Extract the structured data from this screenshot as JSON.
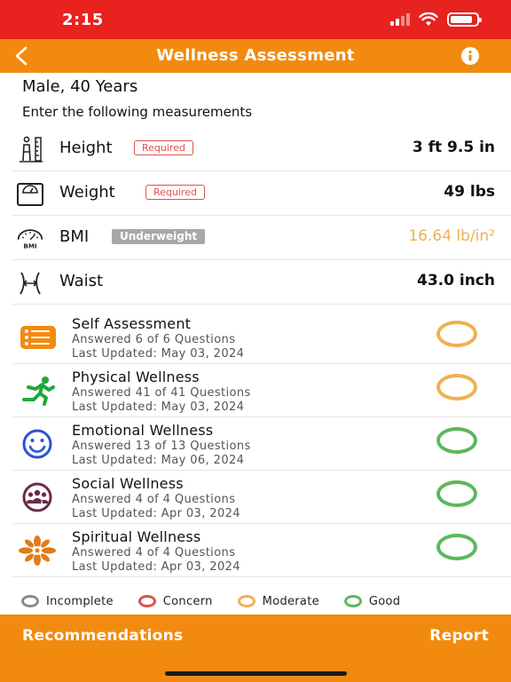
{
  "status_bar": {
    "time": "2:15",
    "battery_level": 0.85
  },
  "nav": {
    "title": "Wellness Assessment",
    "back_icon": "chevron-left-icon",
    "info_icon": "info-icon"
  },
  "profile": {
    "summary": "Male, 40 Years",
    "instruction": "Enter the following measurements"
  },
  "measurements": [
    {
      "label": "Height",
      "badge": "Required",
      "value": "3 ft 9.5 in",
      "icon": "height-icon"
    },
    {
      "label": "Weight",
      "badge": "Required",
      "value": "49 lbs",
      "icon": "scale-icon"
    },
    {
      "label": "BMI",
      "badge": "Underweight",
      "value": "16.64 lb/in²",
      "icon": "bmi-gauge-icon",
      "value_color": "#f0b052"
    },
    {
      "label": "Waist",
      "badge": "",
      "value": "43.0 inch",
      "icon": "waist-icon"
    }
  ],
  "sections": [
    {
      "title": "Self Assessment",
      "answered": "Answered 6 of 6 Questions",
      "updated": "Last Updated: May 03, 2024",
      "status": "Moderate",
      "icon": "checklist-icon"
    },
    {
      "title": "Physical Wellness",
      "answered": "Answered 41 of 41 Questions",
      "updated": "Last Updated: May 03, 2024",
      "status": "Moderate",
      "icon": "running-person-icon"
    },
    {
      "title": "Emotional Wellness",
      "answered": "Answered 13 of 13 Questions",
      "updated": "Last Updated: May 06, 2024",
      "status": "Good",
      "icon": "smiley-icon"
    },
    {
      "title": "Social Wellness",
      "answered": "Answered 4 of 4 Questions",
      "updated": "Last Updated: Apr 03, 2024",
      "status": "Good",
      "icon": "people-group-icon"
    },
    {
      "title": "Spiritual Wellness",
      "answered": "Answered 4 of 4 Questions",
      "updated": "Last Updated: Apr 03, 2024",
      "status": "Good",
      "icon": "lotus-icon"
    }
  ],
  "legend": [
    {
      "label": "Incomplete",
      "color": "#8a8a8a"
    },
    {
      "label": "Concern",
      "color": "#d9534f"
    },
    {
      "label": "Moderate",
      "color": "#f0b052"
    },
    {
      "label": "Good",
      "color": "#5cb85c"
    }
  ],
  "bottom": {
    "recommendations": "Recommendations",
    "report": "Report"
  },
  "colors": {
    "status_bar": "#e8221f",
    "accent": "#f28a10",
    "moderate": "#f0b052",
    "good": "#5cb85c",
    "required": "#e0504c"
  }
}
